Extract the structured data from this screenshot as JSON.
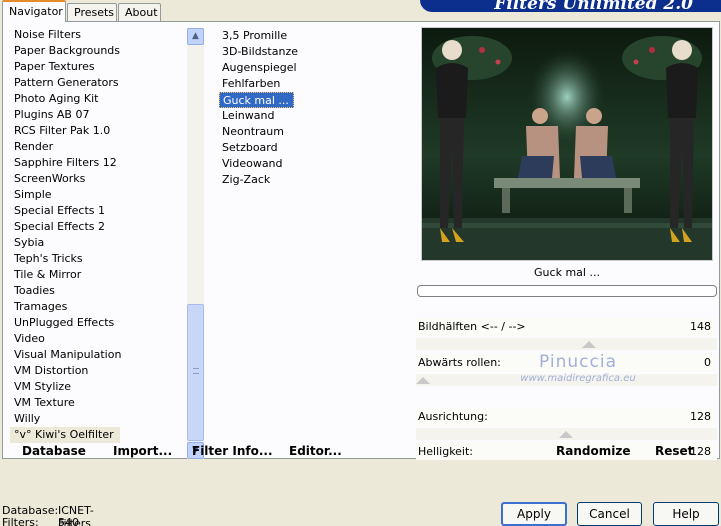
{
  "tabs": [
    "Navigator",
    "Presets",
    "About"
  ],
  "banner": {
    "title": "Filters Unlimited 2.0"
  },
  "categories": [
    "Noise Filters",
    "Paper Backgrounds",
    "Paper Textures",
    "Pattern Generators",
    "Photo Aging Kit",
    "Plugins AB 07",
    "RCS Filter Pak 1.0",
    "Render",
    "Sapphire Filters 12",
    "ScreenWorks",
    "Simple",
    "Special Effects 1",
    "Special Effects 2",
    "Sybia",
    "Teph's Tricks",
    "Tile & Mirror",
    "Toadies",
    "Tramages",
    "UnPlugged Effects",
    "Video",
    "Visual Manipulation",
    "VM Distortion",
    "VM Stylize",
    "VM Texture",
    "Willy",
    "°v° Kiwi's Oelfilter"
  ],
  "selected_category": "°v° Kiwi's Oelfilter",
  "filters": [
    "3,5 Promille",
    "3D-Bildstanze",
    "Augenspiegel",
    "Fehlfarben",
    "Guck mal ...",
    "Leinwand",
    "Neontraum",
    "Setzboard",
    "Videowand",
    "Zig-Zack"
  ],
  "selected_filter": "Guck mal ...",
  "preview": {
    "label": "Guck mal ...",
    "progress": 0
  },
  "params": [
    {
      "label": "Bildhälften <-- / -->",
      "value": "148"
    },
    {
      "label": "Abwärts rollen:",
      "value": "0"
    },
    {
      "label": "Ausrichtung:",
      "value": "128"
    },
    {
      "label": "Helligkeit:",
      "value": "128"
    }
  ],
  "watermark": {
    "line1": "Pinuccia",
    "line2": "www.maidiregrafica.eu"
  },
  "bottom_buttons": {
    "database": "Database",
    "import": "Import...",
    "filter_info": "Filter Info...",
    "editor": "Editor...",
    "randomize": "Randomize",
    "reset": "Reset"
  },
  "status": {
    "database_label": "Database:",
    "database_value": "ICNET-Filters",
    "filters_label": "Filters:",
    "filters_value": "540"
  },
  "dialog_buttons": {
    "apply": "Apply",
    "cancel": "Cancel",
    "help": "Help"
  }
}
